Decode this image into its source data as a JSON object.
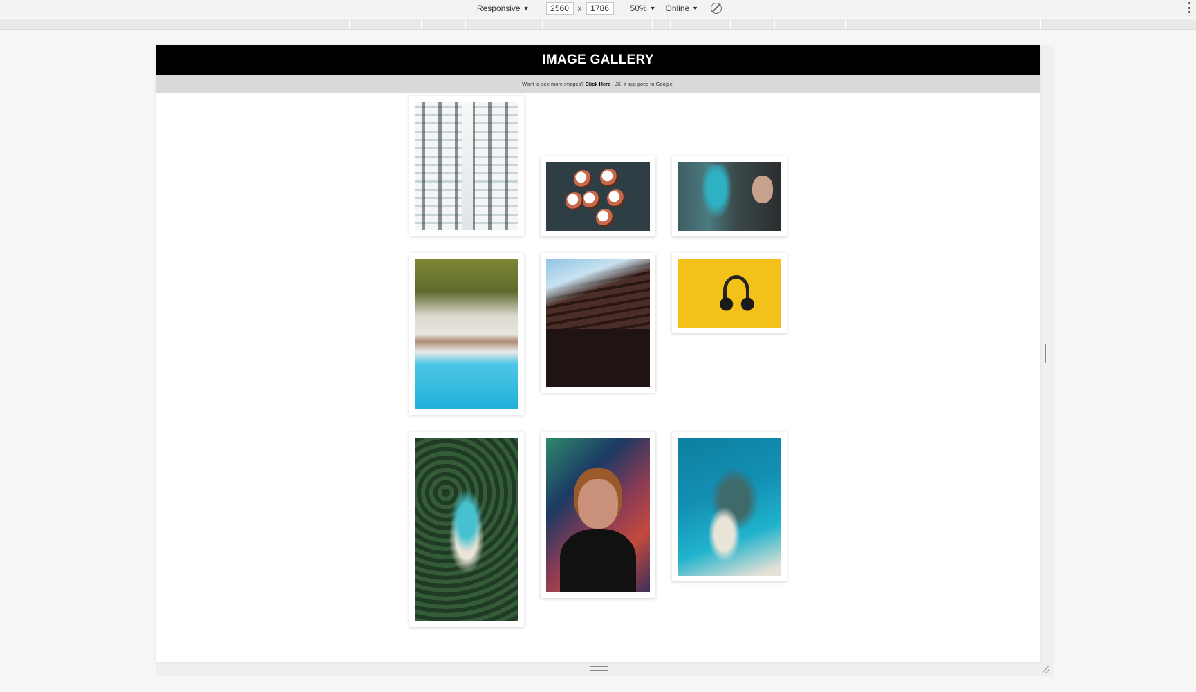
{
  "devtools": {
    "device": "Responsive",
    "width": "2560",
    "height": "1786",
    "times": "x",
    "zoom": "50%",
    "network": "Online",
    "caret": "▼"
  },
  "page": {
    "title": "IMAGE GALLERY",
    "subtitle_before": "Want to see more images?",
    "link_text": "Click Here",
    "subtitle_after": ". JK, it just goes to Google."
  },
  "gallery": [
    {
      "name": "building-windows-photo"
    },
    {
      "name": "cupcakes-photo"
    },
    {
      "name": "graffiti-woman-photo"
    },
    {
      "name": "beach-palms-photo"
    },
    {
      "name": "curved-building-photo"
    },
    {
      "name": "headphones-photo"
    },
    {
      "name": "palm-island-photo"
    },
    {
      "name": "portrait-photo"
    },
    {
      "name": "reef-photo"
    }
  ]
}
